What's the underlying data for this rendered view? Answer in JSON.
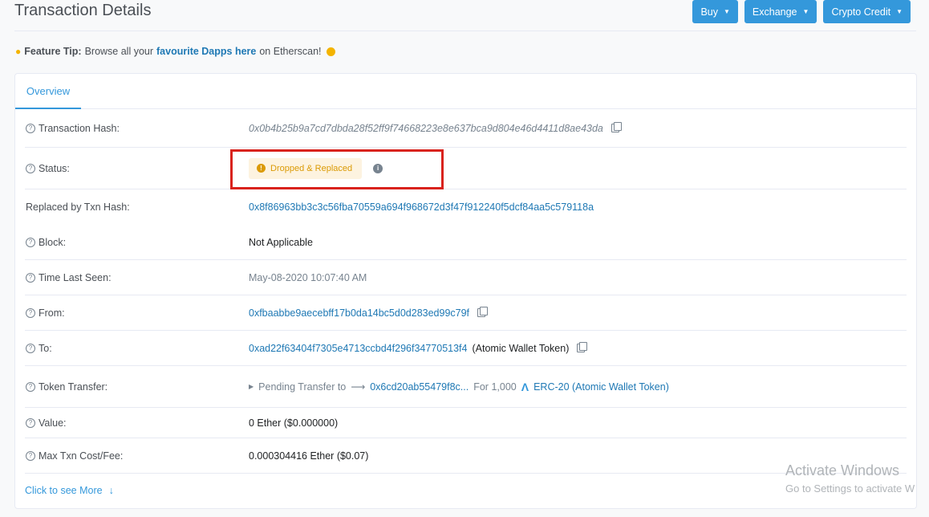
{
  "page": {
    "title": "Transaction Details"
  },
  "top_buttons": [
    {
      "label": "Buy"
    },
    {
      "label": "Exchange"
    },
    {
      "label": "Crypto Credit"
    }
  ],
  "tip": {
    "prefix": "Feature Tip:",
    "text1": "Browse all your",
    "link": "favourite Dapps here",
    "text2": "on Etherscan!"
  },
  "tabs": {
    "overview": "Overview"
  },
  "details": {
    "tx_hash": {
      "label": "Transaction Hash:",
      "value": "0x0b4b25b9a7cd7dbda28f52ff9f74668223e8e637bca9d804e46d4411d8ae43da"
    },
    "status": {
      "label": "Status:",
      "value": "Dropped & Replaced"
    },
    "replaced_by": {
      "label": "Replaced by Txn Hash:",
      "value": "0x8f86963bb3c3c56fba70559a694f968672d3f47f912240f5dcf84aa5c579118a"
    },
    "block": {
      "label": "Block:",
      "value": "Not Applicable"
    },
    "time_last_seen": {
      "label": "Time Last Seen:",
      "value": "May-08-2020 10:07:40 AM"
    },
    "from": {
      "label": "From:",
      "value": "0xfbaabbe9aecebff17b0da14bc5d0d283ed99c79f"
    },
    "to": {
      "label": "To:",
      "value": "0xad22f63404f7305e4713ccbd4f296f34770513f4",
      "name": "(Atomic Wallet Token)"
    },
    "token_transfer": {
      "label": "Token Transfer:",
      "pending": "Pending Transfer to",
      "address": "0x6cd20ab55479f8c...",
      "for": "For 1,000",
      "token": "ERC-20 (Atomic Wallet Token)"
    },
    "value": {
      "label": "Value:",
      "value": "0 Ether ($0.000000)"
    },
    "max_fee": {
      "label": "Max Txn Cost/Fee:",
      "value": "0.000304416 Ether ($0.07)"
    }
  },
  "more_link": "Click to see More",
  "watermark": {
    "line1": "Activate Windows",
    "line2": "Go to Settings to activate W"
  },
  "colors": {
    "accent": "#3498db",
    "link": "#1e78b4",
    "warning": "#db9a04",
    "highlight": "#d9231d"
  }
}
